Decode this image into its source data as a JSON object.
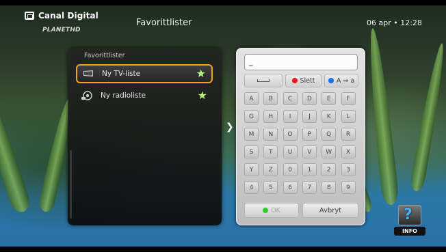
{
  "header": {
    "brand": "Canal Digital",
    "channel_logo": "PLANETHD",
    "title": "Favorittlister",
    "datetime": "06 apr • 12:28"
  },
  "list_panel": {
    "title": "Favorittlister",
    "items": [
      {
        "label": "Ny TV-liste",
        "icon": "tv-icon",
        "selected": true,
        "starred": true
      },
      {
        "label": "Ny radioliste",
        "icon": "radio-icon",
        "selected": false,
        "starred": true
      }
    ]
  },
  "keyboard": {
    "input_value": "_",
    "space_label": "",
    "delete_label": "Slett",
    "case_label": "A ⇒ a",
    "rows": [
      [
        "A",
        "B",
        "C",
        "D",
        "E",
        "F"
      ],
      [
        "G",
        "H",
        "I",
        "J",
        "K",
        "L"
      ],
      [
        "M",
        "N",
        "O",
        "P",
        "Q",
        "R"
      ],
      [
        "S",
        "T",
        "U",
        "V",
        "W",
        "X"
      ],
      [
        "Y",
        "Z",
        "0",
        "1",
        "2",
        "3"
      ],
      [
        "4",
        "5",
        "6",
        "7",
        "8",
        "9"
      ]
    ],
    "ok_label": "OK",
    "cancel_label": "Avbryt"
  },
  "info": {
    "label": "INFO"
  },
  "colors": {
    "highlight": "#f2a223",
    "star": "#b8f27a",
    "delete_dot": "#e81c1c",
    "case_dot": "#1c6fe8",
    "ok_dot": "#33cc33"
  }
}
